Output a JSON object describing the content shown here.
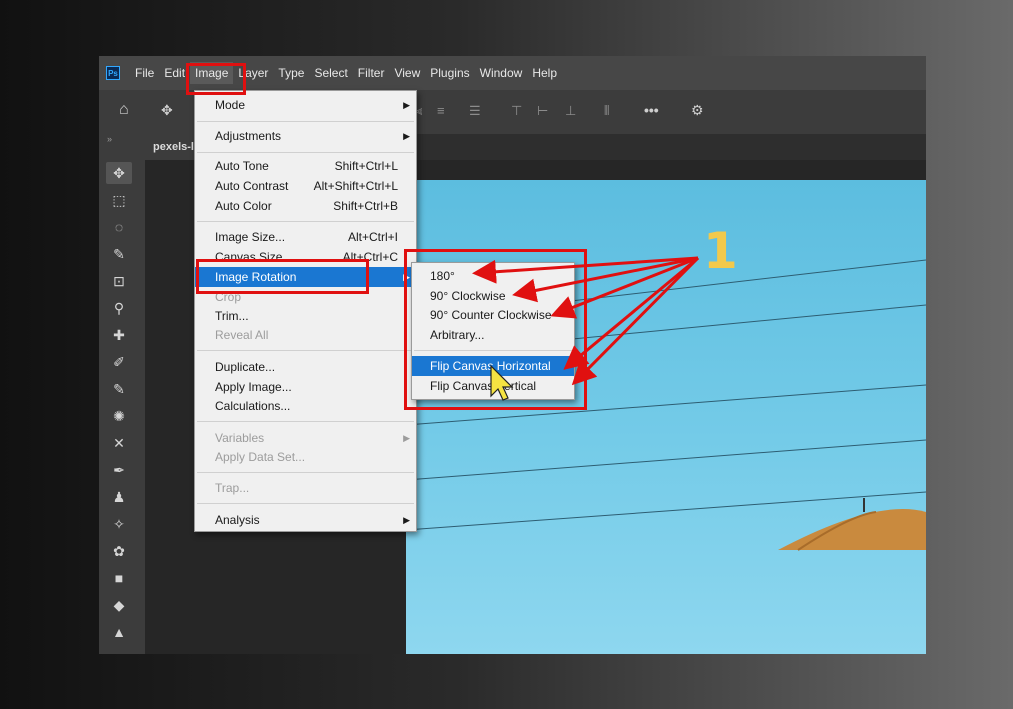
{
  "menubar": {
    "logo": "Ps",
    "items": [
      "File",
      "Edit",
      "Image",
      "Layer",
      "Type",
      "Select",
      "Filter",
      "View",
      "Plugins",
      "Window",
      "Help"
    ],
    "active": "Image"
  },
  "document_tab": "pexels-l",
  "image_menu": [
    {
      "label": "Mode",
      "submenu": true
    },
    {
      "label": "Adjustments",
      "submenu": true
    },
    {
      "label": "Auto Tone",
      "shortcut": "Shift+Ctrl+L"
    },
    {
      "label": "Auto Contrast",
      "shortcut": "Alt+Shift+Ctrl+L"
    },
    {
      "label": "Auto Color",
      "shortcut": "Shift+Ctrl+B"
    },
    {
      "label": "Image Size...",
      "shortcut": "Alt+Ctrl+I"
    },
    {
      "label": "Canvas Size...",
      "shortcut": "Alt+Ctrl+C"
    },
    {
      "label": "Image Rotation",
      "submenu": true,
      "highlighted": true
    },
    {
      "label": "Crop",
      "disabled": true
    },
    {
      "label": "Trim..."
    },
    {
      "label": "Reveal All",
      "disabled": true
    },
    {
      "label": "Duplicate..."
    },
    {
      "label": "Apply Image..."
    },
    {
      "label": "Calculations..."
    },
    {
      "label": "Variables",
      "submenu": true,
      "disabled": true
    },
    {
      "label": "Apply Data Set...",
      "disabled": true
    },
    {
      "label": "Trap...",
      "disabled": true
    },
    {
      "label": "Analysis",
      "submenu": true
    }
  ],
  "rotation_submenu": [
    {
      "label": "180°"
    },
    {
      "label": "90° Clockwise"
    },
    {
      "label": "90° Counter Clockwise"
    },
    {
      "label": "Arbitrary..."
    },
    {
      "label": "Flip Canvas Horizontal",
      "highlighted": true
    },
    {
      "label": "Flip Canvas Vertical"
    }
  ],
  "annotation": {
    "number": "1",
    "color": "#f2c94c",
    "marker_color": "#e01010"
  },
  "icons": [
    "home-icon",
    "move-icon",
    "gear-icon",
    "more-icon",
    "cursor-icon"
  ]
}
